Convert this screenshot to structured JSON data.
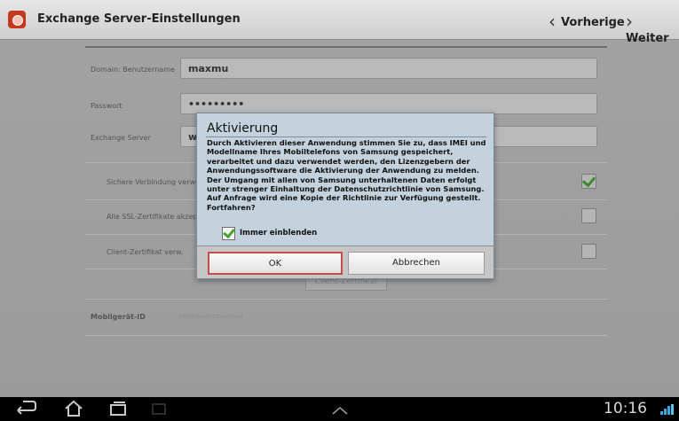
{
  "titlebar": {
    "title": "Exchange Server-Einstellungen",
    "prev_label": "Vorherige",
    "next_label": "Weiter",
    "app_icon": "settings-app-icon",
    "prev_icon": "chevron-left-icon",
    "next_icon": "chevron-right-icon"
  },
  "form": {
    "domain_label": "Domain: Benutzername",
    "domain_value": "maxmu",
    "password_label": "Passwort",
    "password_value": "•••••••••",
    "server_label": "Exchange Server",
    "server_value": "w",
    "secure_label": "Sichere Verbindung verwe",
    "secure_checked": true,
    "ssl_label": "Alle SSL-Zertifikate akzept",
    "ssl_checked": false,
    "client_cert_label": "Client-Zertifikat verw.",
    "client_cert_checked": false,
    "client_cert_button": "Client-Zertifikat",
    "mobile_id_label": "Mobilgerät-ID",
    "mobile_id_value": "SAMSUNG02123947004"
  },
  "dialog": {
    "title": "Aktivierung",
    "message": "Durch Aktivieren dieser Anwendung stimmen Sie zu, dass IMEI und Modellname Ihres Mobiltelefons von Samsung gespeichert, verarbeitet und dazu verwendet werden, den Lizenzgebern der Anwendungssoftware die Aktivierung der Anwendung zu melden. Der Umgang mit allen von Samsung unterhaltenen Daten erfolgt unter strenger Einhaltung der Datenschutzrichtlinie von Samsung. Auf Anfrage wird eine Kopie der Richtlinie zur Verfügung gestellt. Fortfahren?",
    "checkbox_label": "Immer einblenden",
    "checkbox_checked": true,
    "ok_label": "OK",
    "cancel_label": "Abbrechen"
  },
  "systembar": {
    "time": "10:16",
    "icons": [
      "back-icon",
      "home-icon",
      "recent-apps-icon",
      "screenshot-icon",
      "up-arrow-icon",
      "signal-icon"
    ]
  },
  "colors": {
    "accent_check": "#4aa135",
    "ok_focus": "#c24d4d",
    "signal": "#3aa6e0"
  }
}
